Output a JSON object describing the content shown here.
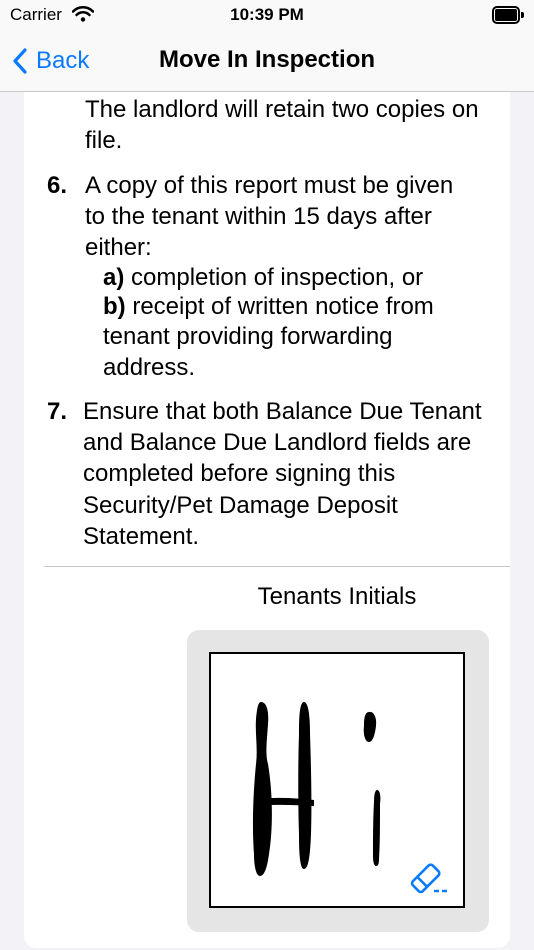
{
  "status_bar": {
    "carrier": "Carrier",
    "time": "10:39 PM"
  },
  "nav": {
    "back_label": "Back",
    "title": "Move In Inspection"
  },
  "content": {
    "intro_lines": [
      "The landlord will retain two copies on",
      "file."
    ],
    "item6": {
      "number": "6.",
      "lines": [
        "A copy of this report must be given",
        "to the tenant within 15 days after",
        "either:"
      ],
      "sub_a_label": "a)",
      "sub_a_text": "completion of inspection, or",
      "sub_b_label": "b)",
      "sub_b_text": "receipt of written notice from",
      "sub_b_lines": [
        "tenant providing forwarding",
        "address."
      ]
    },
    "item7": {
      "number": "7.",
      "lines": [
        "Ensure that both Balance Due Tenant",
        "and Balance Due Landlord fields are",
        "completed before signing this",
        "Security/Pet Damage Deposit",
        "Statement."
      ]
    }
  },
  "signature": {
    "label": "Tenants Initials",
    "eraser_icon": "eraser-icon"
  },
  "colors": {
    "accent": "#0a7aff",
    "background": "#f2f2f7"
  }
}
